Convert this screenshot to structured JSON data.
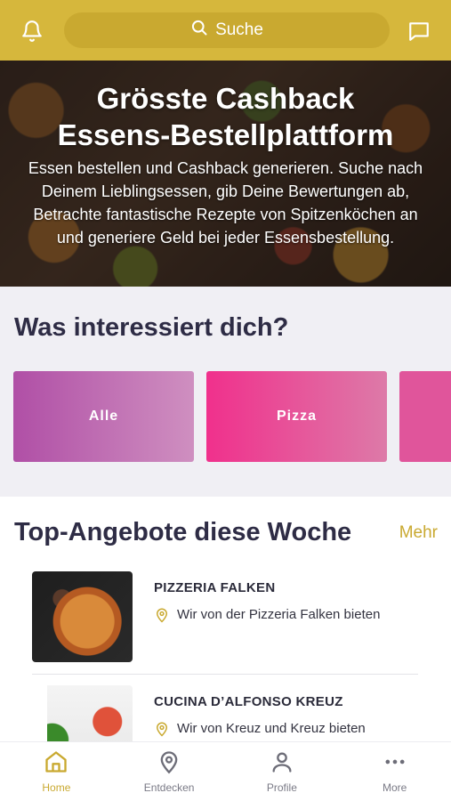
{
  "header": {
    "search_label": "Suche",
    "icons": [
      "bell-icon",
      "search-icon",
      "chat-icon"
    ],
    "accent_color": "#d6b73c"
  },
  "hero": {
    "title_line1": "Grösste Cashback",
    "title_line2": "Essens-Bestellplattform",
    "text": "Essen bestellen und Cashback generieren. Suche nach Deinem Lieblingsessen, gib Deine Bewertungen ab, Betrachte fantastische Rezepte von Spitzenköchen an und generiere Geld bei jeder Essensbestellung."
  },
  "interests": {
    "title": "Was interessiert dich?",
    "categories": [
      {
        "label": "Alle"
      },
      {
        "label": "Pizza"
      },
      {
        "label": ""
      }
    ]
  },
  "offers": {
    "title": "Top-Angebote diese Woche",
    "more_label": "Mehr",
    "items": [
      {
        "name": "PIZZERIA FALKEN",
        "description": "Wir von der Pizzeria Falken bieten"
      },
      {
        "name": "CUCINA D’ALFONSO KREUZ",
        "description": "Wir von Kreuz und Kreuz bieten Spitzenk"
      }
    ]
  },
  "nav": {
    "items": [
      {
        "label": "Home",
        "icon": "home-icon",
        "active": true
      },
      {
        "label": "Entdecken",
        "icon": "location-icon",
        "active": false
      },
      {
        "label": "Profile",
        "icon": "user-icon",
        "active": false
      },
      {
        "label": "More",
        "icon": "more-icon",
        "active": false
      }
    ]
  }
}
